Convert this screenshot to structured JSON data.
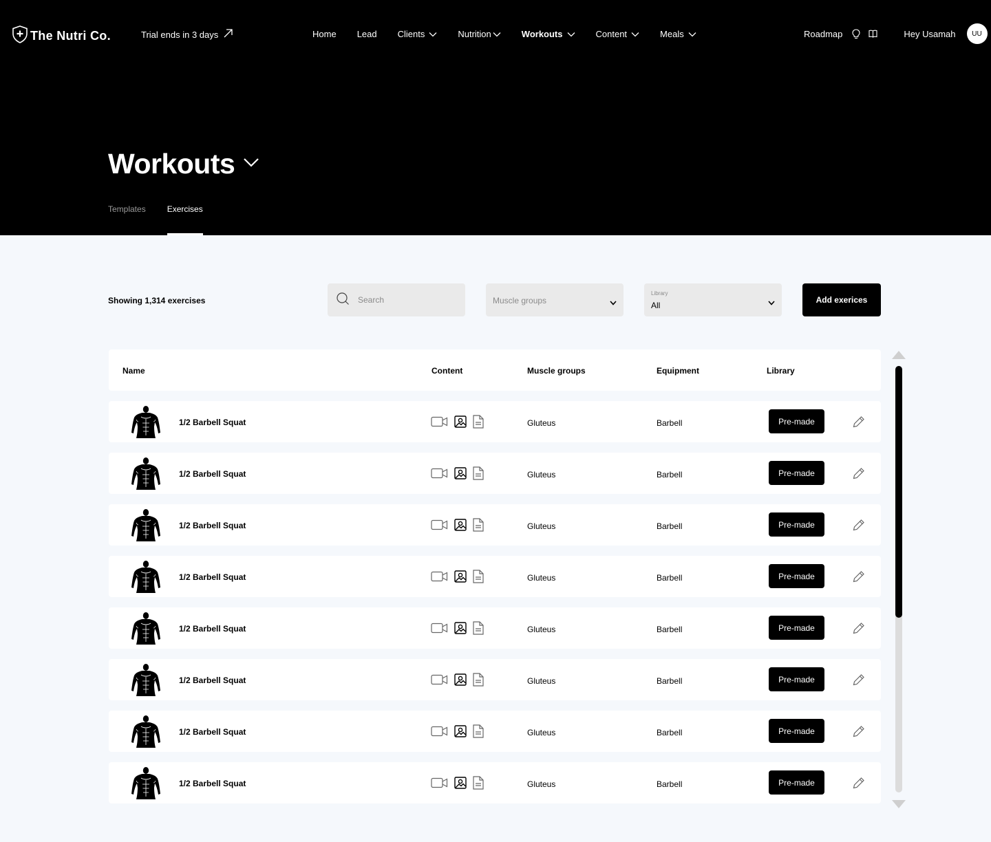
{
  "brand": {
    "name": "The Nutri Co."
  },
  "trial": {
    "text": "Trial ends in 3 days"
  },
  "nav": {
    "home": "Home",
    "lead": "Lead",
    "clients": "Clients",
    "nutrition": "Nutrition",
    "workouts": "Workouts",
    "content": "Content",
    "meals": "Meals"
  },
  "user_nav": {
    "roadmap": "Roadmap",
    "greeting": "Hey Usamah",
    "avatar_initials": "UU"
  },
  "page": {
    "title": "Workouts",
    "tabs": {
      "templates": "Templates",
      "exercises": "Exercises"
    }
  },
  "filters": {
    "showing": "Showing 1,314 exercises",
    "search_placeholder": "Search",
    "muscle_placeholder": "Muscle groups",
    "library_label": "Library",
    "library_value": "All",
    "add_button": "Add exerices"
  },
  "table": {
    "headers": {
      "name": "Name",
      "content": "Content",
      "muscle_groups": "Muscle groups",
      "equipment": "Equipment",
      "library": "Library"
    },
    "rows": [
      {
        "name": "1/2 Barbell Squat",
        "muscle": "Gluteus",
        "equipment": "Barbell",
        "library": "Pre-made"
      },
      {
        "name": "1/2 Barbell Squat",
        "muscle": "Gluteus",
        "equipment": "Barbell",
        "library": "Pre-made"
      },
      {
        "name": "1/2 Barbell Squat",
        "muscle": "Gluteus",
        "equipment": "Barbell",
        "library": "Pre-made"
      },
      {
        "name": "1/2 Barbell Squat",
        "muscle": "Gluteus",
        "equipment": "Barbell",
        "library": "Pre-made"
      },
      {
        "name": "1/2 Barbell Squat",
        "muscle": "Gluteus",
        "equipment": "Barbell",
        "library": "Pre-made"
      },
      {
        "name": "1/2 Barbell Squat",
        "muscle": "Gluteus",
        "equipment": "Barbell",
        "library": "Pre-made"
      },
      {
        "name": "1/2 Barbell Squat",
        "muscle": "Gluteus",
        "equipment": "Barbell",
        "library": "Pre-made"
      },
      {
        "name": "1/2 Barbell Squat",
        "muscle": "Gluteus",
        "equipment": "Barbell",
        "library": "Pre-made"
      }
    ]
  },
  "icons": {
    "logo": "shield-plus-icon",
    "trial_link": "arrow-up-right-icon",
    "dropdown": "chevron-down-icon",
    "idea": "lightbulb-icon",
    "docs": "book-icon",
    "search": "search-icon",
    "content_video": "video-icon",
    "content_image": "image-icon",
    "content_doc": "document-icon",
    "edit": "pencil-icon",
    "exercise_thumb": "muscle-figure-icon"
  },
  "colors": {
    "header_bg": "#000000",
    "page_bg": "#f5f8fc",
    "accent": "#000000"
  }
}
